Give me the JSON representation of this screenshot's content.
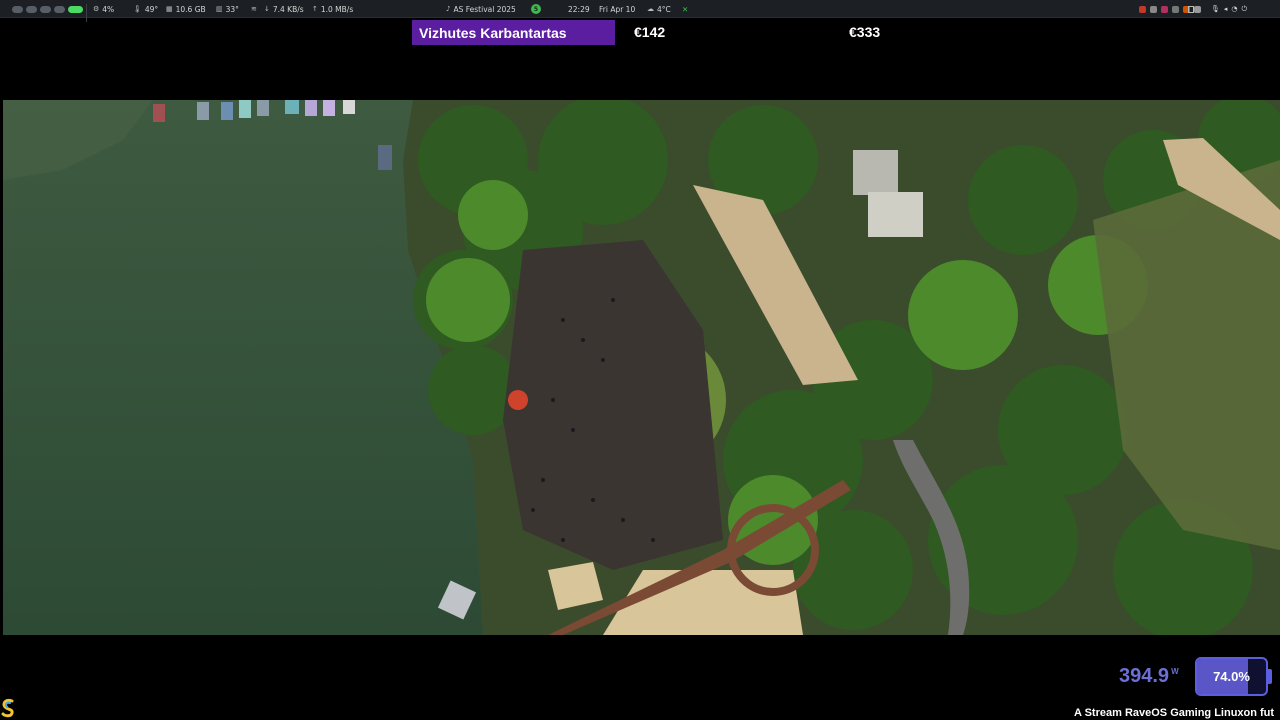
{
  "topbar": {
    "cpu": "4%",
    "cpu_temp": "49°",
    "memory": "10.6 GB",
    "gpu_temp": "33°",
    "net_down": "7.4 KB/s",
    "net_up": "1.0 MB/s",
    "media_title": "AS Festival 2025",
    "time": "22:29",
    "date": "Fri Apr 10",
    "weather": "4°C",
    "workspace_active": 5
  },
  "ticker": {
    "name": "Vizhutes Karbantartas",
    "price_1": "€142",
    "price_2": "€333"
  },
  "power": {
    "watts": "394.9",
    "unit": "W",
    "battery_label": "74.0%",
    "battery_level": 0.74
  },
  "marquee": {
    "text": "A Stream RaveOS Gaming Linuxon fut"
  },
  "colors": {
    "accent": "#5b1ea0",
    "battery": "#5b56c8",
    "watt": "#6b6fd6",
    "workspace_active": "#4cd964"
  }
}
